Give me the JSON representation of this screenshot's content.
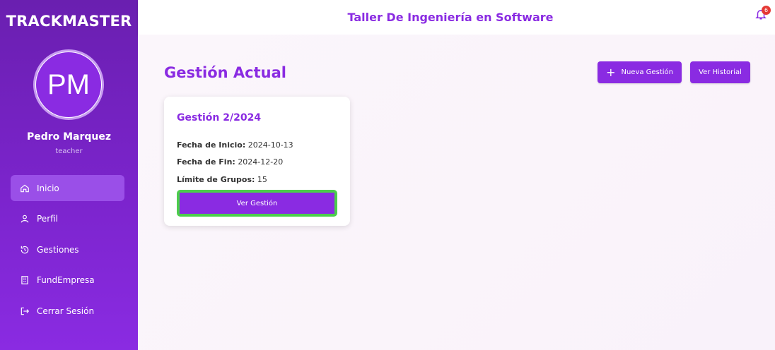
{
  "app": {
    "brand": "TRACKMASTER"
  },
  "user": {
    "initials": "PM",
    "name": "Pedro Marquez",
    "role": "teacher"
  },
  "sidebar": {
    "items": [
      {
        "label": "Inicio",
        "icon": "home-icon",
        "active": true
      },
      {
        "label": "Perfil",
        "icon": "user-icon",
        "active": false
      },
      {
        "label": "Gestiones",
        "icon": "history-icon",
        "active": false
      },
      {
        "label": "FundEmpresa",
        "icon": "building-icon",
        "active": false
      },
      {
        "label": "Cerrar Sesión",
        "icon": "logout-icon",
        "active": false
      }
    ]
  },
  "header": {
    "title": "Taller De Ingeniería en Software",
    "notifications_count": "6"
  },
  "main": {
    "title": "Gestión Actual",
    "new_button": "Nueva Gestión",
    "history_button": "Ver Historial",
    "card": {
      "title": "Gestión 2/2024",
      "start_label": "Fecha de Inicio:",
      "start_value": "2024-10-13",
      "end_label": "Fecha de Fin:",
      "end_value": "2024-12-20",
      "limit_label": "Límite de Grupos:",
      "limit_value": "15",
      "view_button": "Ver Gestión"
    }
  },
  "colors": {
    "accent": "#8a2be2",
    "highlight": "#4ccd4c",
    "badge": "#e53935"
  }
}
